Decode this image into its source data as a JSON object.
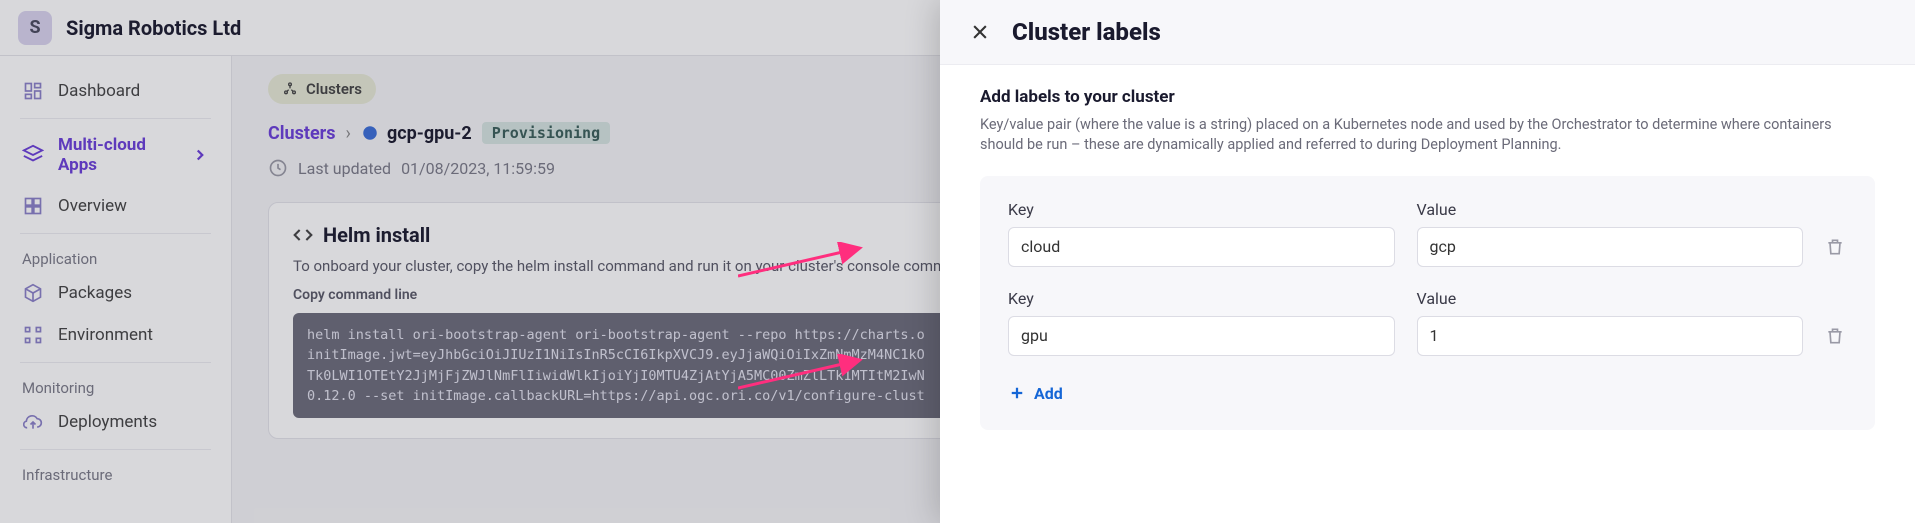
{
  "org": {
    "badge": "S",
    "name": "Sigma Robotics Ltd"
  },
  "sidebar": {
    "dashboard": "Dashboard",
    "multicloud": "Multi-cloud Apps",
    "overview": "Overview",
    "section_app": "Application",
    "packages": "Packages",
    "environment": "Environment",
    "section_mon": "Monitoring",
    "deployments": "Deployments",
    "section_infra": "Infrastructure"
  },
  "main": {
    "clusters_pill": "Clusters",
    "bc_clusters": "Clusters",
    "cluster_name": "gcp-gpu-2",
    "status": "Provisioning",
    "updated_label": "Last updated",
    "updated_value": "01/08/2023, 11:59:59",
    "helm_title": "Helm install",
    "helm_sub": "To onboard your cluster, copy the helm install command and run it on your cluster's console comma",
    "copy_label": "Copy command line",
    "cmd": "helm install ori-bootstrap-agent ori-bootstrap-agent --repo https://charts.o\ninitImage.jwt=eyJhbGciOiJIUzI1NiIsInR5cCI6IkpXVCJ9.eyJjaWQiOiIxZmNmMzM4NC1kO\nTk0LWI1OTEtY2JjMjFjZWJlNmFlIiwidWlkIjoiYjI0MTU4ZjAtYjA5MC00ZmZlLTk1MTItM2IwN\n0.12.0 --set initImage.callbackURL=https://api.ogc.ori.co/v1/configure-clust"
  },
  "drawer": {
    "title": "Cluster labels",
    "intro_title": "Add labels to your cluster",
    "intro_text": "Key/value pair (where the value is a string) placed on a Kubernetes node and used by the Orchestrator to determine where containers should be run – these are dynamically applied and referred to during Deployment Planning.",
    "key_label": "Key",
    "value_label": "Value",
    "rows": [
      {
        "key": "cloud",
        "value": "gcp"
      },
      {
        "key": "gpu",
        "value": "1"
      }
    ],
    "add": "Add"
  }
}
